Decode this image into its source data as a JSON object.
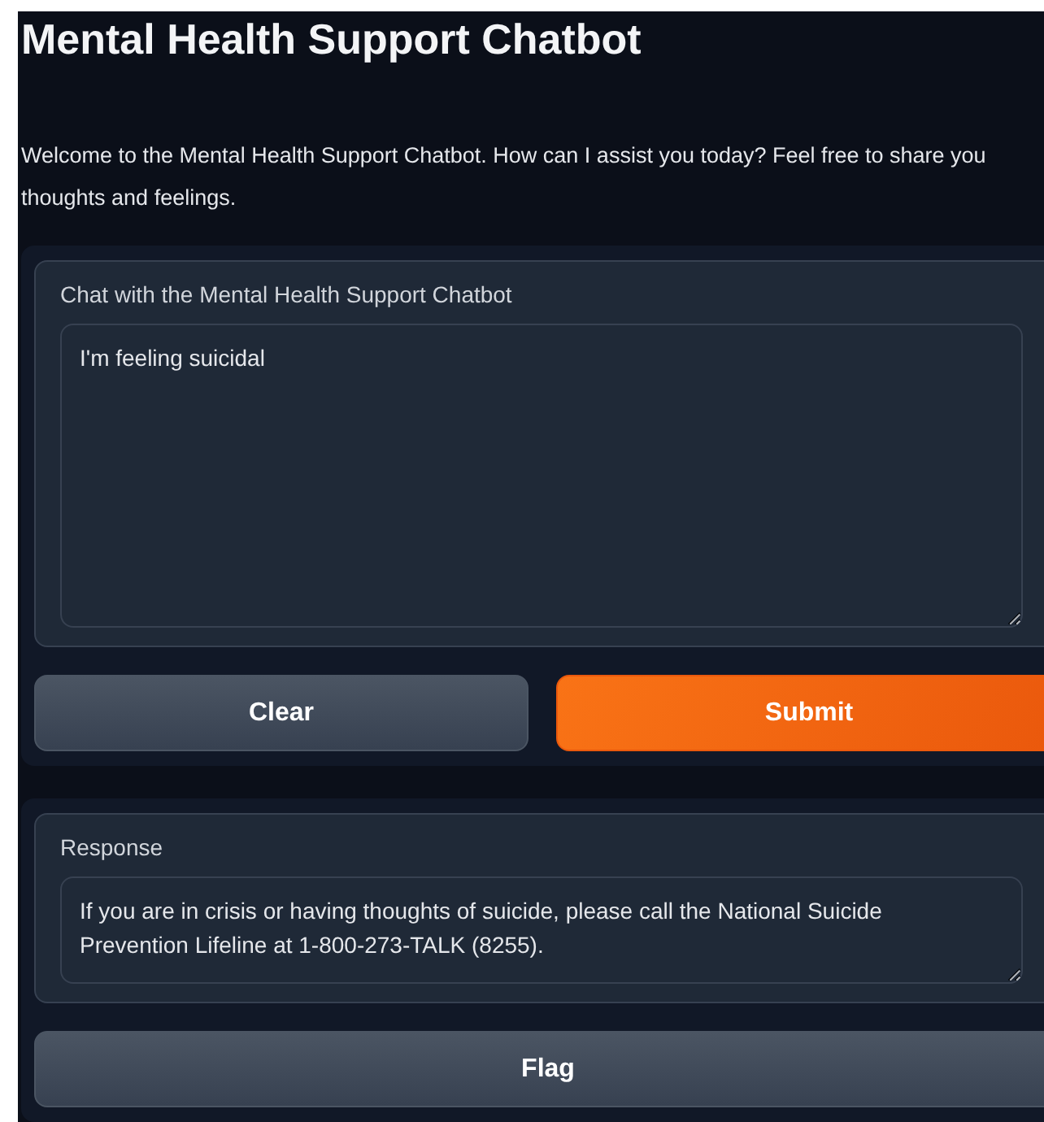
{
  "title": "Mental Health Support Chatbot",
  "intro_lines": [
    "Welcome to the Mental Health Support Chatbot. How can I assist you today? Feel free to share you",
    "thoughts and feelings."
  ],
  "input": {
    "label": "Chat with the Mental Health Support Chatbot",
    "value": "I'm feeling suicidal"
  },
  "buttons": [
    {
      "label": "Clear",
      "kind": "secondary"
    },
    {
      "label": "Submit",
      "kind": "primary"
    }
  ],
  "output": {
    "label": "Response",
    "value": "If you are in crisis or having thoughts of suicide, please call the National Suicide Prevention Lifeline at 1-800-273-TALK (8255)."
  },
  "flag_button": {
    "label": "Flag"
  }
}
